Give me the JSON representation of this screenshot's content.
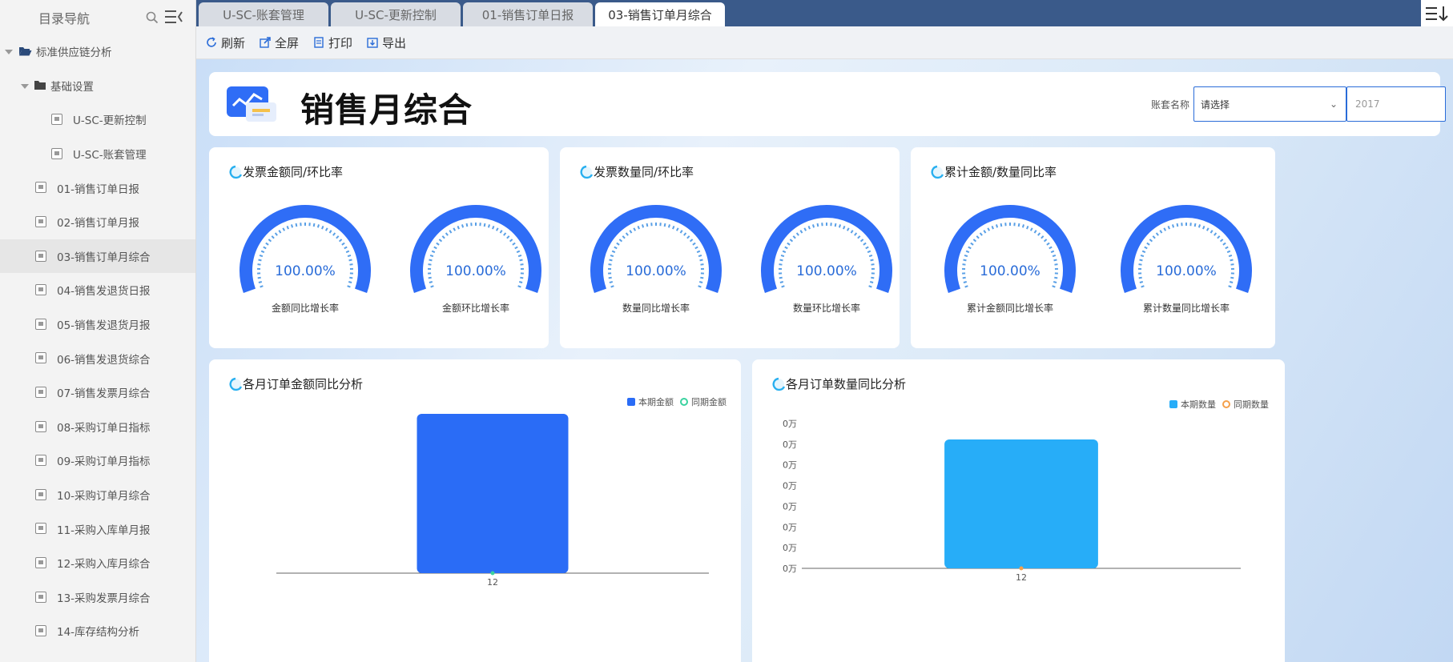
{
  "sidebar": {
    "title": "目录导航",
    "items": [
      {
        "label": "标准供应链分析",
        "kind": "folder-open"
      },
      {
        "label": "基础设置",
        "kind": "folder"
      },
      {
        "label": "U-SC-更新控制",
        "kind": "doc"
      },
      {
        "label": "U-SC-账套管理",
        "kind": "doc"
      },
      {
        "label": "01-销售订单日报",
        "kind": "doc"
      },
      {
        "label": "02-销售订单月报",
        "kind": "doc"
      },
      {
        "label": "03-销售订单月综合",
        "kind": "doc",
        "active": true
      },
      {
        "label": "04-销售发退货日报",
        "kind": "doc"
      },
      {
        "label": "05-销售发退货月报",
        "kind": "doc"
      },
      {
        "label": "06-销售发退货综合",
        "kind": "doc"
      },
      {
        "label": "07-销售发票月综合",
        "kind": "doc"
      },
      {
        "label": "08-采购订单日指标",
        "kind": "doc"
      },
      {
        "label": "09-采购订单月指标",
        "kind": "doc"
      },
      {
        "label": "10-采购订单月综合",
        "kind": "doc"
      },
      {
        "label": "11-采购入库单月报",
        "kind": "doc"
      },
      {
        "label": "12-采购入库月综合",
        "kind": "doc"
      },
      {
        "label": "13-采购发票月综合",
        "kind": "doc"
      },
      {
        "label": "14-库存结构分析",
        "kind": "doc"
      }
    ]
  },
  "tabs": [
    {
      "label": "U-SC-账套管理"
    },
    {
      "label": "U-SC-更新控制"
    },
    {
      "label": "01-销售订单日报"
    },
    {
      "label": "03-销售订单月综合",
      "active": true
    }
  ],
  "toolbar": {
    "refresh": "刷新",
    "fullscreen": "全屏",
    "print": "打印",
    "export": "导出"
  },
  "header": {
    "title": "销售月综合",
    "filter_label": "账套名称",
    "select_value": "请选择",
    "year_value": "2017"
  },
  "colors": {
    "accent": "#2a6cd8",
    "gauge_blue": "#2f6df6",
    "bar_amount": "#2a6cf6",
    "bar_qty": "#27adf8",
    "prior_amount": "#3ad29f",
    "prior_qty": "#f5a04a",
    "tab_bar": "#3a5a8a"
  },
  "gauge_cards": [
    {
      "title": "发票金额同/环比率",
      "gauges": [
        {
          "value": "100.00%",
          "label": "金额同比增长率"
        },
        {
          "value": "100.00%",
          "label": "金额环比增长率"
        }
      ]
    },
    {
      "title": "发票数量同/环比率",
      "gauges": [
        {
          "value": "100.00%",
          "label": "数量同比增长率"
        },
        {
          "value": "100.00%",
          "label": "数量环比增长率"
        }
      ]
    },
    {
      "title": "累计金额/数量同比率",
      "gauges": [
        {
          "value": "100.00%",
          "label": "累计金额同比增长率"
        },
        {
          "value": "100.00%",
          "label": "累计数量同比增长率"
        }
      ]
    }
  ],
  "chart_cards": [
    {
      "title": "各月订单金额同比分析"
    },
    {
      "title": "各月订单数量同比分析"
    }
  ],
  "chart_data": [
    {
      "type": "bar",
      "categories": [
        "12"
      ],
      "series": [
        {
          "name": "本期金额",
          "values": [
            1
          ]
        },
        {
          "name": "同期金额",
          "values": [
            0
          ]
        }
      ],
      "title": "各月订单金额同比分析",
      "xlabel": "",
      "ylabel": "",
      "grid": false,
      "legend": "top-right"
    },
    {
      "type": "bar",
      "categories": [
        "12"
      ],
      "series": [
        {
          "name": "本期数量",
          "values": [
            1
          ]
        },
        {
          "name": "同期数量",
          "values": [
            0
          ]
        }
      ],
      "title": "各月订单数量同比分析",
      "xlabel": "",
      "ylabel": "",
      "yticks": [
        "0万",
        "0万",
        "0万",
        "0万",
        "0万",
        "0万",
        "0万",
        "0万"
      ],
      "grid": false,
      "legend": "top-right"
    }
  ]
}
